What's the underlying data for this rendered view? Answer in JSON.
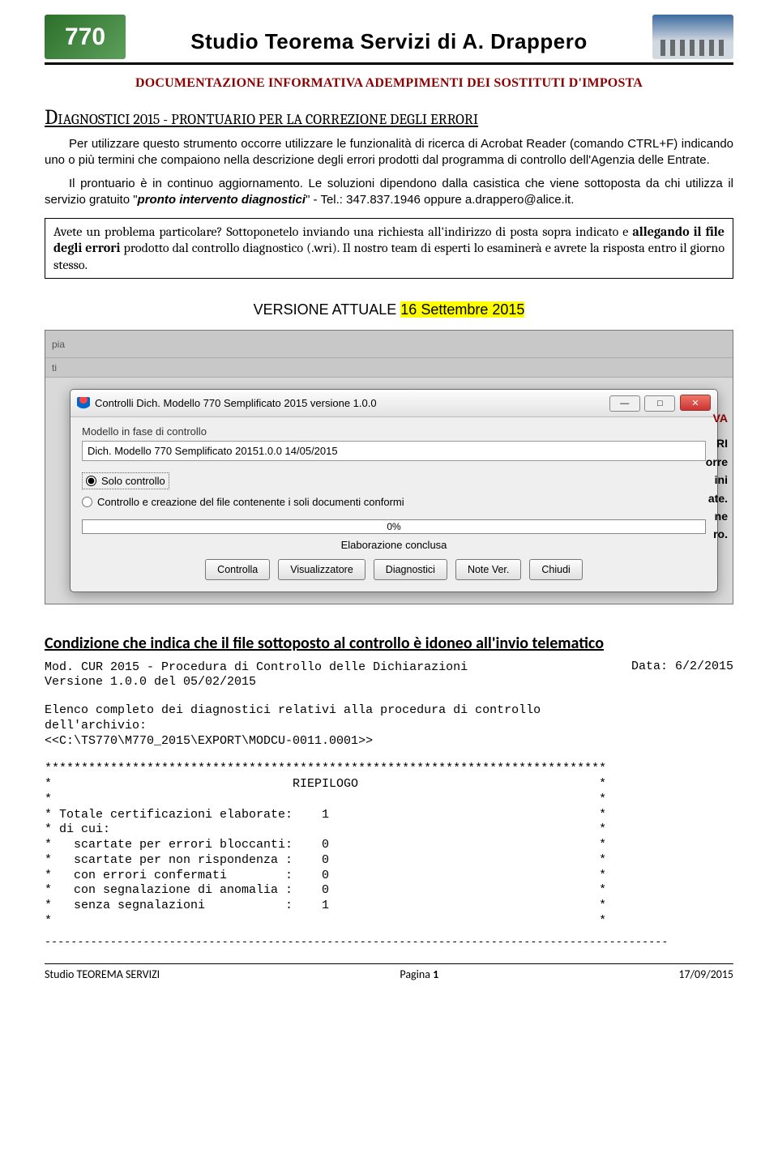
{
  "header": {
    "logoText": "770",
    "studio": "Studio  Teorema Servizi  di A. Drappero",
    "sub": "DOCUMENTAZIONE INFORMATIVA ADEMPIMENTI DEI SOSTITUTI D'IMPOSTA"
  },
  "title": {
    "d": "D",
    "rest1": "IAGNOSTICI 2015 - P",
    "rest2": "RONTUARIO PER LA CORREZIONE DEGLI ERRORI"
  },
  "p1": "Per utilizzare questo strumento occorre utilizzare le funzionalità di ricerca di Acrobat Reader (comando CTRL+F) indicando uno o più termini che compaiono nella descrizione degli errori prodotti dal programma di controllo dell'Agenzia delle Entrate.",
  "p2a": "Il prontuario è in continuo aggiornamento. Le soluzioni dipendono dalla casistica che viene sottoposta da chi utilizza il servizio gratuito \"",
  "p2ital": "pronto intervento diagnostici",
  "p2b": "\" - Tel.: 347.837.1946 oppure a.drappero@alice.it.",
  "box": {
    "t1": "Avete un problema particolare? Sottoponetelo inviando una richiesta all'indirizzo di posta sopra indicato e ",
    "bold": "allegando il file degli errori",
    "t2": " prodotto dal controllo diagnostico (.wri).  Il nostro team di esperti lo esaminerà e avrete la risposta entro il giorno stesso."
  },
  "version": {
    "label": "VERSIONE ATTUALE  ",
    "date": "16 Settembre 2015"
  },
  "screenshot": {
    "toolbarHint": "pia",
    "toolbarHint2": "ti",
    "winTitle": "Controlli Dich. Modello 770 Semplificato 2015 versione 1.0.0",
    "label1": "Modello in fase di controllo",
    "field1": "Dich. Modello 770 Semplificato 20151.0.0   14/05/2015",
    "radio1": "Solo controllo",
    "radio2": "Controllo e creazione del file contenente i soli documenti conformi",
    "progressPct": "0%",
    "status": "Elaborazione conclusa",
    "buttons": [
      "Controlla",
      "Visualizzatore",
      "Diagnostici",
      "Note Ver.",
      "Chiudi"
    ],
    "sideRed": "VA",
    "sideBlack": "RI\norre\nini\nate.\nne\nro."
  },
  "cond": "Condizione che indica che il file sottoposto al controllo è idoneo all'invio telematico",
  "monoDate": "Data: 6/2/2015",
  "mono1": "Mod. CUR 2015 - Procedura di Controllo delle Dichiarazioni\nVersione 1.0.0 del 05/02/2015",
  "mono2": "Elenco completo dei diagnostici relativi alla procedura di controllo\ndell'archivio:\n<<C:\\TS770\\M770_2015\\EXPORT\\MODCU-0011.0001>>",
  "riepilogo": "*****************************************************************************\n*                                 RIEPILOGO                                 *\n*                                                                           *\n* Totale certificazioni elaborate:    1                                     *\n* di cui:                                                                   *\n*   scartate per errori bloccanti:    0                                     *\n*   scartate per non rispondenza :    0                                     *\n*   con errori confermati        :    0                                     *\n*   con segnalazione di anomalia :    0                                     *\n*   senza segnalazioni           :    1                                     *\n*                                                                           *",
  "dashes": "-----------------------------------------------------------------------------------------------",
  "footer": {
    "left": "Studio TEOREMA SERVIZI",
    "centerA": "Pagina ",
    "centerB": "1",
    "right": "17/09/2015"
  }
}
